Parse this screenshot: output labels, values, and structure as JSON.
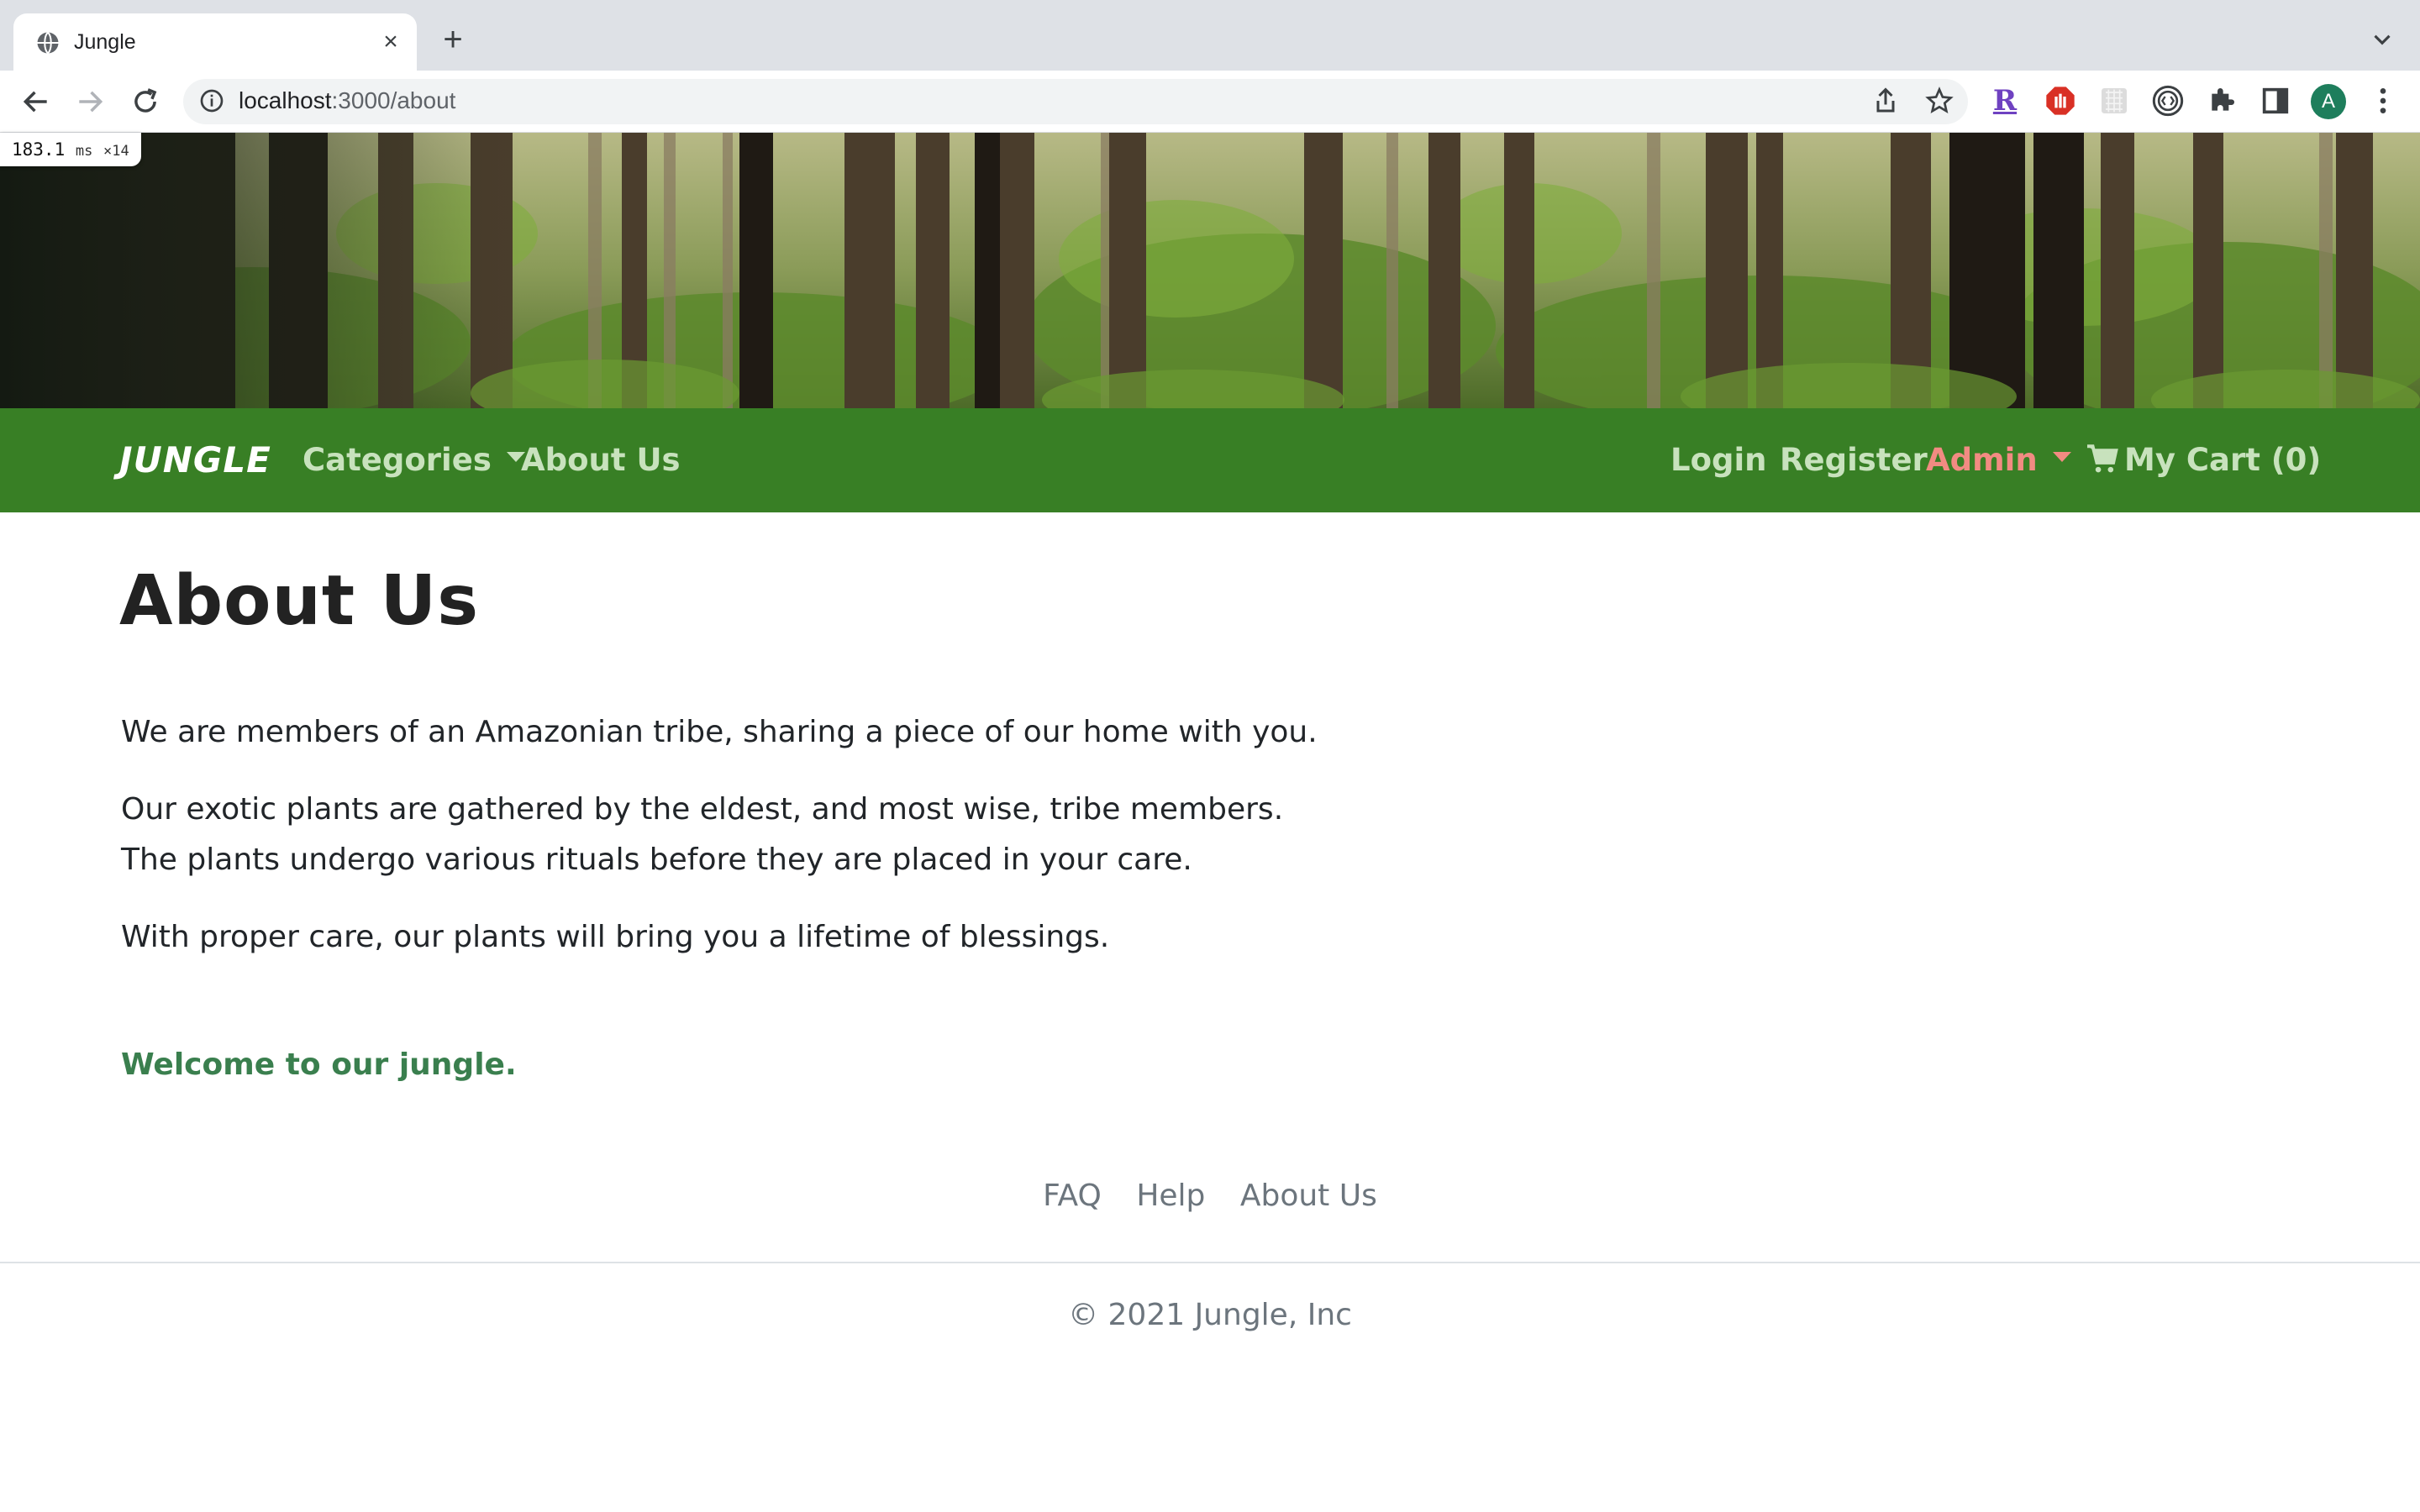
{
  "browser": {
    "tab_title": "Jungle",
    "tab_close": "×",
    "new_tab": "+",
    "url_host": "localhost",
    "url_path": ":3000/about",
    "profile_initial": "A",
    "ext_r_label": "R"
  },
  "timing": {
    "value": "183.1",
    "unit": "ms",
    "count": "×14"
  },
  "navbar": {
    "brand": "JUNGLE",
    "categories": "Categories",
    "about": "About Us",
    "login": "Login",
    "register": "Register",
    "admin": "Admin",
    "cart": "My Cart (0)"
  },
  "main": {
    "title": "About Us",
    "paragraphs": [
      "We are members of an Amazonian tribe, sharing a piece of our home with you.",
      "Our exotic plants are gathered by the eldest, and most wise, tribe members.",
      "The plants undergo various rituals before they are placed in your care.",
      "With proper care, our plants will bring you a lifetime of blessings."
    ],
    "welcome": "Welcome to our jungle."
  },
  "footer": {
    "links": [
      "FAQ",
      "Help",
      "About Us"
    ],
    "copyright": "© 2021 Jungle, Inc"
  },
  "colors": {
    "navbar": "#387f25",
    "nav_link": "#c8e2bd",
    "admin": "#f28b82",
    "welcome": "#3a7f4e"
  }
}
